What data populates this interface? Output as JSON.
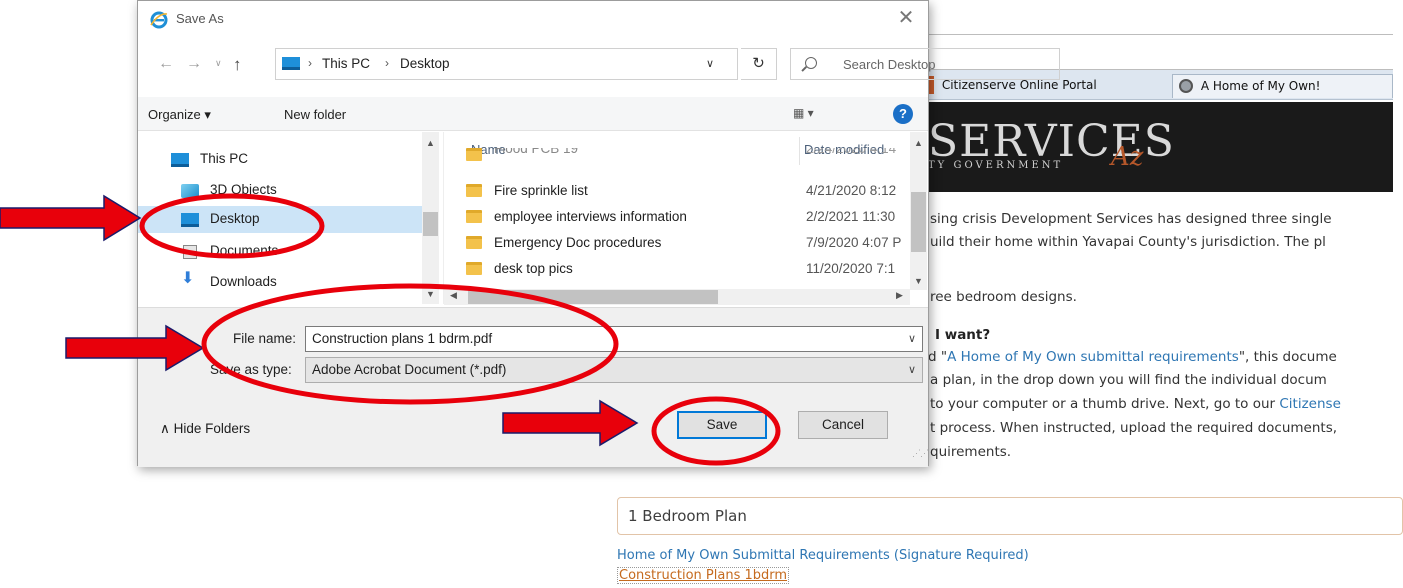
{
  "browser": {
    "tabs": [
      {
        "label": "Citizenserve Online Portal"
      },
      {
        "label": "A Home of My Own!"
      }
    ],
    "banner": {
      "title": "SERVICES",
      "suffix": "Az",
      "subtitle": "TY GOVERNMENT"
    }
  },
  "page": {
    "paragraph_lines": [
      "sing crisis Development Services has designed three single",
      "uild their home within Yavapai County's jurisdiction. The pl"
    ],
    "three_designs": "ree bedroom designs.",
    "question": "I want?",
    "req_line": {
      "prefix": "d \"",
      "link": "A Home of My Own submittal requirements",
      "suffix": "\", this docume"
    },
    "line_drop": "a plan, in the drop down you will find the individual docum",
    "line_computer": {
      "text": "to your computer or a thumb drive. Next, go to our ",
      "link": "Citizense"
    },
    "line_process": "t process. When instructed, upload the required documents,",
    "line_requirements": "quirements.",
    "bedroom_title": "1 Bedroom Plan",
    "link_requirements": "Home of My Own Submittal Requirements (Signature Required)",
    "link_plans": "Construction Plans 1bdrm"
  },
  "dialog": {
    "title": "Save As",
    "close_glyph": "✕",
    "nav": {
      "back": "←",
      "forward": "→",
      "recent": "∨",
      "up": "↑"
    },
    "address": {
      "crumbs": [
        "This PC",
        "Desktop"
      ],
      "separator": "›",
      "dropdown": "∨",
      "refresh": "↻"
    },
    "search_placeholder": "Search Desktop",
    "toolbar": {
      "organize": "Organize ▾",
      "new_folder": "New folder",
      "view": "▦ ▾",
      "help": "?"
    },
    "nav_pane": [
      {
        "label": "This PC",
        "icon": "pc-icon"
      },
      {
        "label": "3D Objects",
        "icon": "3d-objects-icon"
      },
      {
        "label": "Desktop",
        "icon": "desktop-icon",
        "selected": true
      },
      {
        "label": "Documents",
        "icon": "documents-icon"
      },
      {
        "label": "Downloads",
        "icon": "downloads-icon"
      }
    ],
    "columns": {
      "name": "Name",
      "date": "Date modified"
    },
    "files": [
      {
        "name": "Flood PCB 19",
        "date": "2/24/2020 4:14"
      },
      {
        "name": "Fire sprinkle list",
        "date": "4/21/2020 8:12"
      },
      {
        "name": "employee interviews information",
        "date": "2/2/2021 11:30"
      },
      {
        "name": "Emergency Doc procedures",
        "date": "7/9/2020 4:07 P"
      },
      {
        "name": "desk top pics",
        "date": "11/20/2020 7:1"
      }
    ],
    "file_name_label": "File name:",
    "file_name_value": "Construction plans 1 bdrm.pdf",
    "save_type_label": "Save as type:",
    "save_type_value": "Adobe Acrobat Document (*.pdf)",
    "hide_folders": "∧  Hide Folders",
    "save_label": "Save",
    "cancel_label": "Cancel"
  },
  "annotation_colors": {
    "arrow": "#e8000b",
    "ellipse": "#e8000b",
    "arrow_outline": "#1b1b6b"
  }
}
